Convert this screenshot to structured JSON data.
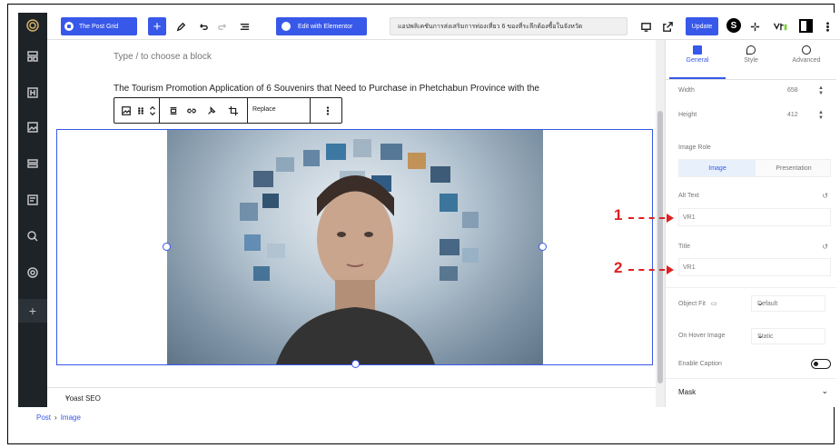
{
  "toolbar": {
    "post_grid_label": "The Post Grid",
    "elementor_label": "Edit with Elementor",
    "post_title": "แอปพลิเคชันการส่งเสริมการท่องเที่ยว 6 ของที่ระลึกต้องซื้อในจังหวัด",
    "update_label": "Update"
  },
  "editor": {
    "placeholder": "Type / to choose a block",
    "paragraph": "The Tourism Promotion Application of 6 Souvenirs that Need to Purchase in Phetchabun Province with the",
    "block_toolbar": {
      "replace_label": "Replace"
    },
    "yoast_label": "Yoast SEO"
  },
  "panel": {
    "tabs": [
      {
        "label": "General",
        "icon": "square-icon"
      },
      {
        "label": "Style",
        "icon": "droplet-icon"
      },
      {
        "label": "Advanced",
        "icon": "gear-icon"
      }
    ],
    "width_label": "Width",
    "width_value": "658",
    "height_label": "Height",
    "height_value": "412",
    "image_role_label": "Image Role",
    "role_image": "Image",
    "role_presentation": "Presentation",
    "alt_text_label": "Alt Text",
    "alt_text_value": "VR1",
    "title_label": "Title",
    "title_value": "VR1",
    "object_fit_label": "Object Fit",
    "object_fit_value": "Default",
    "on_hover_label": "On Hover Image",
    "on_hover_value": "Static",
    "enable_caption_label": "Enable Caption",
    "enable_caption_on": false,
    "mask_label": "Mask"
  },
  "annotations": [
    {
      "label": "1"
    },
    {
      "label": "2"
    }
  ],
  "breadcrumb": {
    "post": "Post",
    "separator": "›",
    "image": "Image"
  },
  "colors": {
    "accent": "#3858e9",
    "annotation": "#e02020",
    "admin_bar": "#1d2327"
  }
}
